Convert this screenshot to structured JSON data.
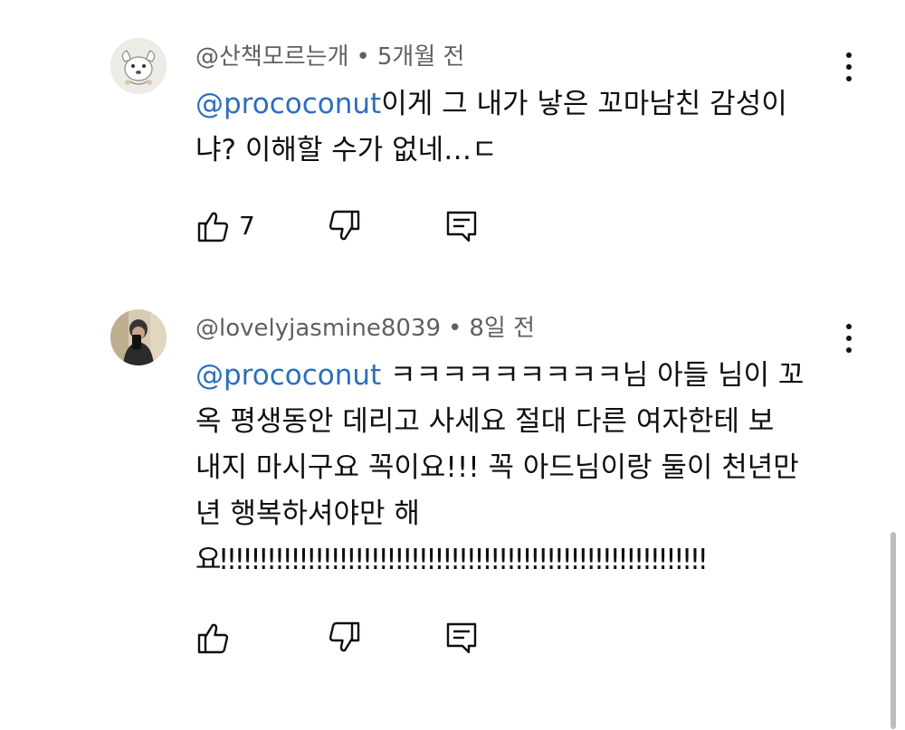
{
  "comments": [
    {
      "author": "@산책모르는개",
      "separator": "•",
      "time": "5개월 전",
      "mention": "@prococonut",
      "text_lines": [
        "이게 그 내가 낳은 꼬마남친 감성이",
        "냐? 이해할 수가 없네…ㄷ"
      ],
      "like_count": "7",
      "avatar_icon": "puppy-cartoon-avatar"
    },
    {
      "author": "@lovelyjasmine8039",
      "separator": "•",
      "time": "8일 전",
      "mention": "@prococonut",
      "text_lines": [
        " ㅋㅋㅋㅋㅋㅋㅋㅋㅋ님 아들 님이 꼬",
        "옥 평생동안 데리고 사세요 절대 다른 여자한테 보",
        "내지 마시구요 꼭이요!!! 꼭 아드님이랑 둘이 천년만",
        "년 행복하셔야만 해",
        "요!!!!!!!!!!!!!!!!!!!!!!!!!!!!!!!!!!!!!!!!!!!!!!!!!!!!!!!!!!!!!"
      ],
      "like_count": "",
      "avatar_icon": "mirror-selfie-photo-avatar"
    }
  ],
  "icons": {
    "like": "thumbs-up-icon",
    "dislike": "thumbs-down-icon",
    "reply": "reply-comment-icon",
    "more": "more-vertical-icon"
  },
  "colors": {
    "mention": "#2b6fbd",
    "meta_text": "#606060",
    "text": "#0f0f0f"
  }
}
